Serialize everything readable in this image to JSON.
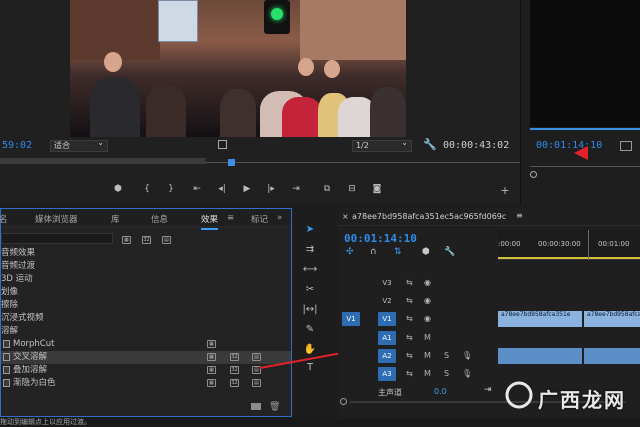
{
  "program_monitor": {
    "timecode_left": "59:02",
    "fit_label": "适合",
    "quality_label": "1/2",
    "duration": "00:00:43:02"
  },
  "source_monitor": {
    "timecode": "00:01:14:10"
  },
  "effects_panel": {
    "tabs": [
      "名",
      "媒体浏览器",
      "库",
      "信息",
      "效果",
      "标记"
    ],
    "active_tab": "效果",
    "tree": [
      {
        "label": "音频效果",
        "selected": false
      },
      {
        "label": "音频过渡",
        "selected": false
      },
      {
        "label": "3D 运动",
        "selected": false
      },
      {
        "label": "划像",
        "selected": false
      },
      {
        "label": "擦除",
        "selected": false
      },
      {
        "label": "沉浸式视频",
        "selected": false
      },
      {
        "label": "溶解",
        "selected": false
      },
      {
        "label": "MorphCut",
        "selected": false
      },
      {
        "label": "交叉溶解",
        "selected": true
      },
      {
        "label": "叠加溶解",
        "selected": false
      },
      {
        "label": "渐隐为白色",
        "selected": false
      }
    ]
  },
  "timeline": {
    "sequence_name": "a78ee7bd958afca351ec5ac965fd069c",
    "timecode": "00:01:14:10",
    "ruler_ticks": [
      ":00:00",
      "00:00:30:00",
      "00:01:00"
    ],
    "tracks": [
      {
        "source": "",
        "label": "V3"
      },
      {
        "source": "",
        "label": "V2"
      },
      {
        "source": "V1",
        "label": "V1"
      },
      {
        "source": "",
        "label": "A1"
      },
      {
        "source": "",
        "label": "A2"
      },
      {
        "source": "",
        "label": "A3"
      }
    ],
    "clip_name_1": "a78ee7bd958afca351e",
    "clip_name_2": "a78ee7bd958afca351ec5",
    "master_label": "主声道",
    "master_value": "0.0",
    "track_letters": {
      "m": "M",
      "s": "S"
    }
  },
  "status_bar": {
    "text": "拖动到编辑点上以应用过渡。"
  },
  "watermark": {
    "text": "广西龙网"
  },
  "colors": {
    "accent": "#2d8ceb",
    "panel_border": "#2d6fc9",
    "track_on": "#2f6db3",
    "arrow": "#e0232a"
  }
}
